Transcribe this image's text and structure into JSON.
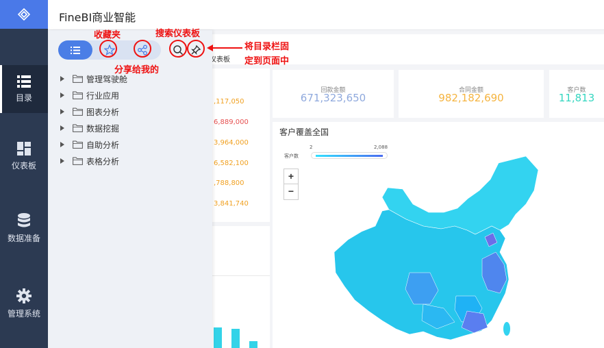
{
  "app": {
    "title": "FineBI商业智能"
  },
  "nav": {
    "items": [
      {
        "label": "目录",
        "icon": "list-icon"
      },
      {
        "label": "仪表板",
        "icon": "dashboard-icon"
      },
      {
        "label": "数据准备",
        "icon": "database-icon"
      },
      {
        "label": "管理系统",
        "icon": "gear-icon"
      }
    ]
  },
  "dashboard": {
    "tab_partial": "仪表板",
    "kpis": [
      {
        "label": "回款金额",
        "value": "671,323,650",
        "color": "#8fa9dd"
      },
      {
        "label": "合同金额",
        "value": "982,182,690",
        "color": "#f5b440"
      },
      {
        "label": "客户数",
        "value": "11,813",
        "color": "#35d6c0"
      }
    ],
    "left_values": [
      ",117,050",
      "6,889,000",
      "3,964,000",
      "6,582,100",
      ",788,800",
      "3,841,740"
    ],
    "map": {
      "title": "客户覆盖全国",
      "legend_label": "客户数",
      "legend_min": "2",
      "legend_max": "2,088",
      "zoom_in": "+",
      "zoom_out": "−"
    }
  },
  "drawer": {
    "tree": [
      {
        "label": "管理驾驶舱"
      },
      {
        "label": "行业应用"
      },
      {
        "label": "图表分析"
      },
      {
        "label": "数据挖掘"
      },
      {
        "label": "自助分析"
      },
      {
        "label": "表格分析"
      }
    ]
  },
  "annotations": {
    "favorites": "收藏夹",
    "share": "分享给我的",
    "search": "搜索仪表板",
    "pin_line1": "将目录栏固",
    "pin_line2": "定到页面中"
  },
  "colors": {
    "accent": "#4b7ee6",
    "nav_bg": "#2c3a52",
    "annotation": "#ee1111"
  }
}
